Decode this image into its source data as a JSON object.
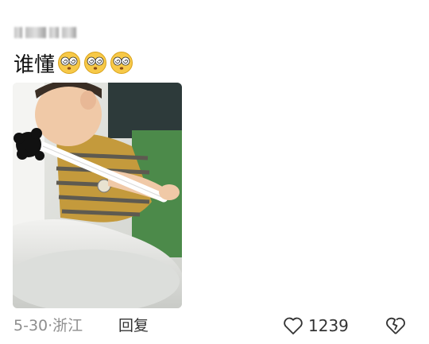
{
  "post": {
    "username": "",
    "text": "谁懂",
    "emoji_icons": [
      "dizzy-eyes-emoji",
      "dizzy-eyes-emoji",
      "dizzy-eyes-emoji"
    ]
  },
  "footer": {
    "meta": "5-30·浙江",
    "reply_label": "回复",
    "like_count": "1239"
  },
  "colors": {
    "meta_text": "#8e8e8e",
    "primary_text": "#111111",
    "emoji_face": "#f7c948"
  }
}
